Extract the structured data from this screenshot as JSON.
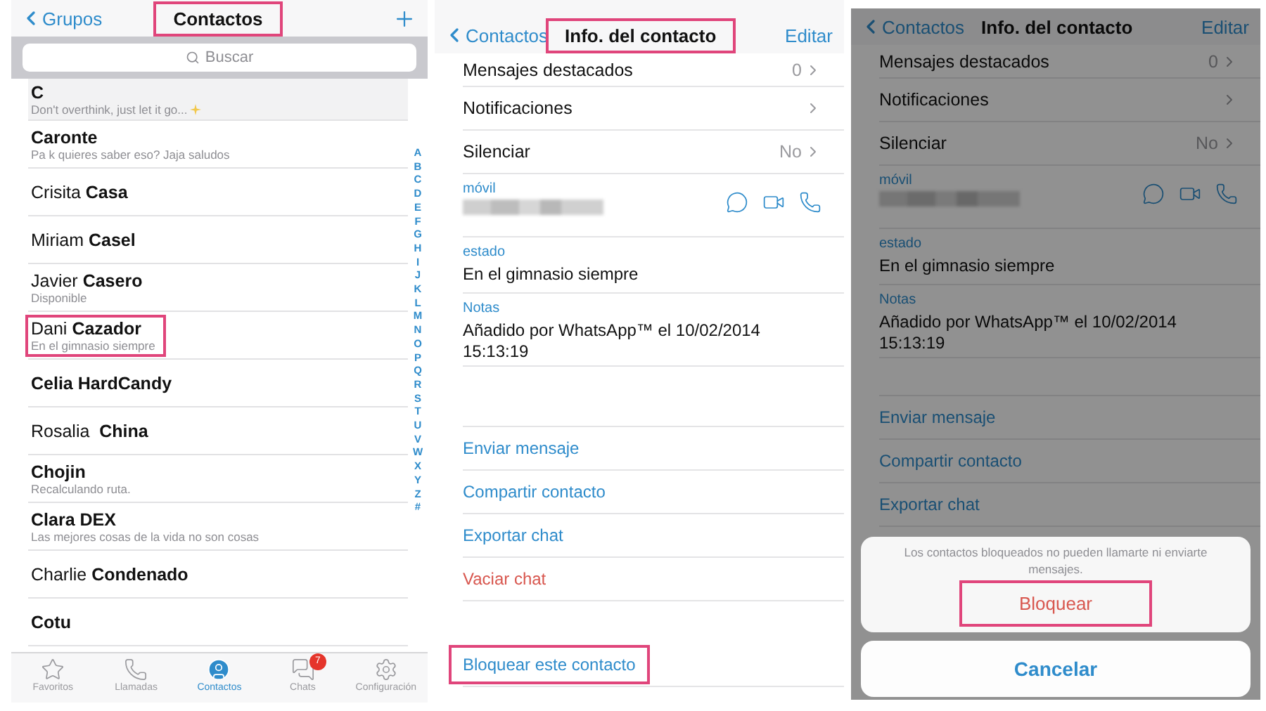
{
  "contacts_screen": {
    "nav": {
      "back": "Grupos",
      "title": "Contactos",
      "title_highlighted": true
    },
    "search": {
      "placeholder": "Buscar"
    },
    "contacts": [
      {
        "name": "C",
        "bold": true,
        "status": "Don't overthink, just let it go...",
        "sparkle": true,
        "highlighted": false
      },
      {
        "name": "Caronte",
        "bold": true,
        "status": "Pa k quieres saber eso? Jaja saludos",
        "highlighted": false
      },
      {
        "name": "Crisita **Casa**",
        "bold": false,
        "highlighted": false
      },
      {
        "name": "Miriam **Casel**",
        "bold": false,
        "highlighted": false
      },
      {
        "name": "Javier **Casero**",
        "bold": false,
        "status": "Disponible",
        "highlighted": false
      },
      {
        "name": "Dani **Cazador**",
        "bold": false,
        "status": "En el gimnasio siempre",
        "highlighted": true
      },
      {
        "name": "Celia HardCandy",
        "bold": true,
        "highlighted": false
      },
      {
        "name": "Rosalia  **China**",
        "bold": false,
        "highlighted": false
      },
      {
        "name": "Chojin",
        "bold": true,
        "status": "Recalculando ruta.",
        "highlighted": false
      },
      {
        "name": "Clara DEX",
        "bold": true,
        "status": "Las mejores cosas de la vida no son cosas",
        "highlighted": false
      },
      {
        "name": "Charlie **Condenado**",
        "bold": false,
        "highlighted": false
      },
      {
        "name": "Cotu",
        "bold": true,
        "highlighted": false
      }
    ],
    "index": [
      "A",
      "B",
      "C",
      "D",
      "E",
      "F",
      "G",
      "H",
      "I",
      "J",
      "K",
      "L",
      "M",
      "N",
      "O",
      "P",
      "Q",
      "R",
      "S",
      "T",
      "U",
      "V",
      "W",
      "X",
      "Y",
      "Z",
      "#"
    ],
    "tabs": [
      {
        "label": "Favoritos",
        "kind": "star",
        "selected": false
      },
      {
        "label": "Llamadas",
        "kind": "phone",
        "selected": false
      },
      {
        "label": "Contactos",
        "kind": "contact",
        "selected": true
      },
      {
        "label": "Chats",
        "kind": "chats",
        "selected": false,
        "badge": "7"
      },
      {
        "label": "Configuración",
        "kind": "settings",
        "selected": false
      }
    ]
  },
  "info_screen": {
    "nav": {
      "back": "Contactos",
      "title": "Info. del contacto",
      "title_highlighted": true,
      "action": "Editar"
    },
    "settings": [
      {
        "label": "Mensajes destacados",
        "value": "0"
      },
      {
        "label": "Notificaciones"
      },
      {
        "label": "Silenciar",
        "value": "No"
      }
    ],
    "phone": {
      "label": "móvil"
    },
    "status": {
      "label": "estado",
      "text": "En el gimnasio siempre"
    },
    "notes": {
      "label": "Notas",
      "lines": [
        "Añadido por WhatsApp™ el 10/02/2014",
        "15:13:19"
      ]
    },
    "actions": [
      {
        "label": "Enviar mensaje",
        "kind": "normal"
      },
      {
        "label": "Compartir contacto",
        "kind": "normal"
      },
      {
        "label": "Exportar chat",
        "kind": "normal"
      },
      {
        "label": "Vaciar chat",
        "kind": "destructive"
      }
    ],
    "block": {
      "label": "Bloquear este contacto",
      "highlighted": true
    }
  },
  "block_screen": {
    "nav": {
      "back": "Contactos",
      "title": "Info. del contacto",
      "title_highlighted": false,
      "action": "Editar"
    },
    "settings": [
      {
        "label": "Mensajes destacados",
        "value": "0"
      },
      {
        "label": "Notificaciones"
      },
      {
        "label": "Silenciar",
        "value": "No"
      }
    ],
    "phone": {
      "label": "móvil"
    },
    "status": {
      "label": "estado",
      "text": "En el gimnasio siempre"
    },
    "notes": {
      "label": "Notas",
      "lines": [
        "Añadido por WhatsApp™ el 10/02/2014",
        "15:13:19"
      ]
    },
    "actions": [
      {
        "label": "Enviar mensaje",
        "kind": "normal"
      },
      {
        "label": "Compartir contacto",
        "kind": "normal"
      },
      {
        "label": "Exportar chat",
        "kind": "normal"
      }
    ],
    "sheet": {
      "message": "Los contactos bloqueados no pueden llamarte ni enviarte mensajes.",
      "confirm": {
        "label": "Bloquear",
        "highlighted": true
      },
      "cancel": "Cancelar"
    }
  }
}
